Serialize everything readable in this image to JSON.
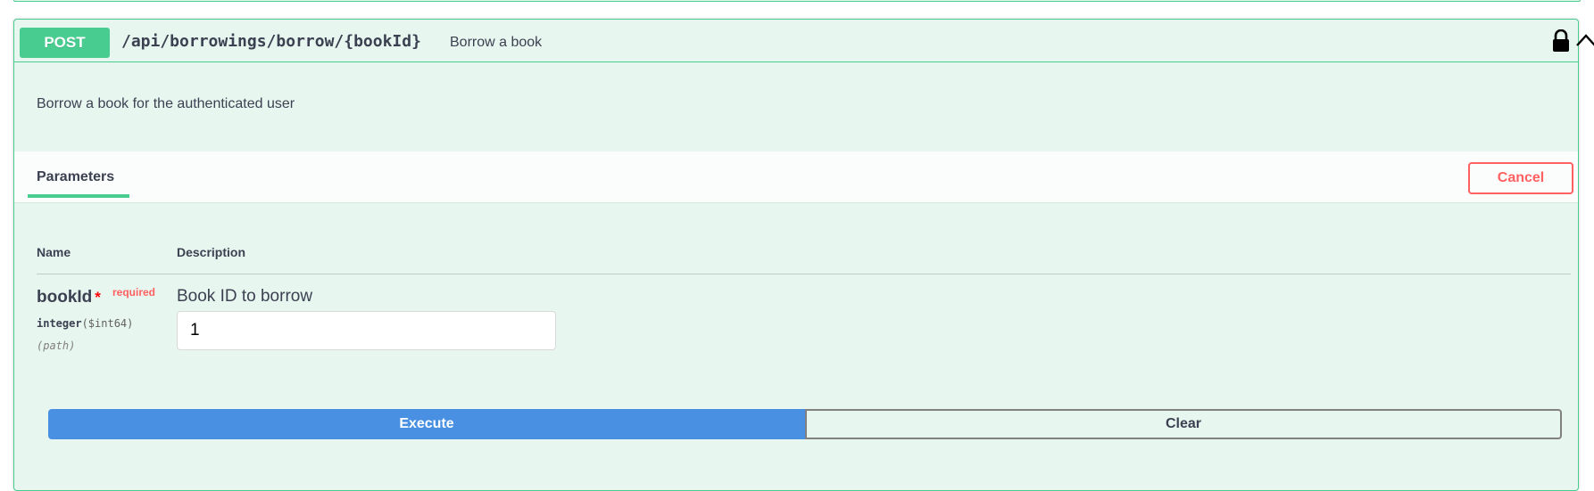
{
  "operation": {
    "method": "POST",
    "path": "/api/borrowings/borrow/{bookId}",
    "summary": "Borrow a book",
    "description": "Borrow a book for the authenticated user"
  },
  "tabs": {
    "parameters_label": "Parameters",
    "cancel_label": "Cancel"
  },
  "table": {
    "col_name": "Name",
    "col_description": "Description"
  },
  "param": {
    "name": "bookId",
    "required_star": "*",
    "required_label": "required",
    "type": "integer",
    "format": "($int64)",
    "location": "(path)",
    "description": "Book ID to borrow",
    "value": "1"
  },
  "actions": {
    "execute_label": "Execute",
    "clear_label": "Clear"
  },
  "colors": {
    "post": "#49cc90",
    "execute": "#4990e2",
    "cancel": "#ff6060"
  }
}
